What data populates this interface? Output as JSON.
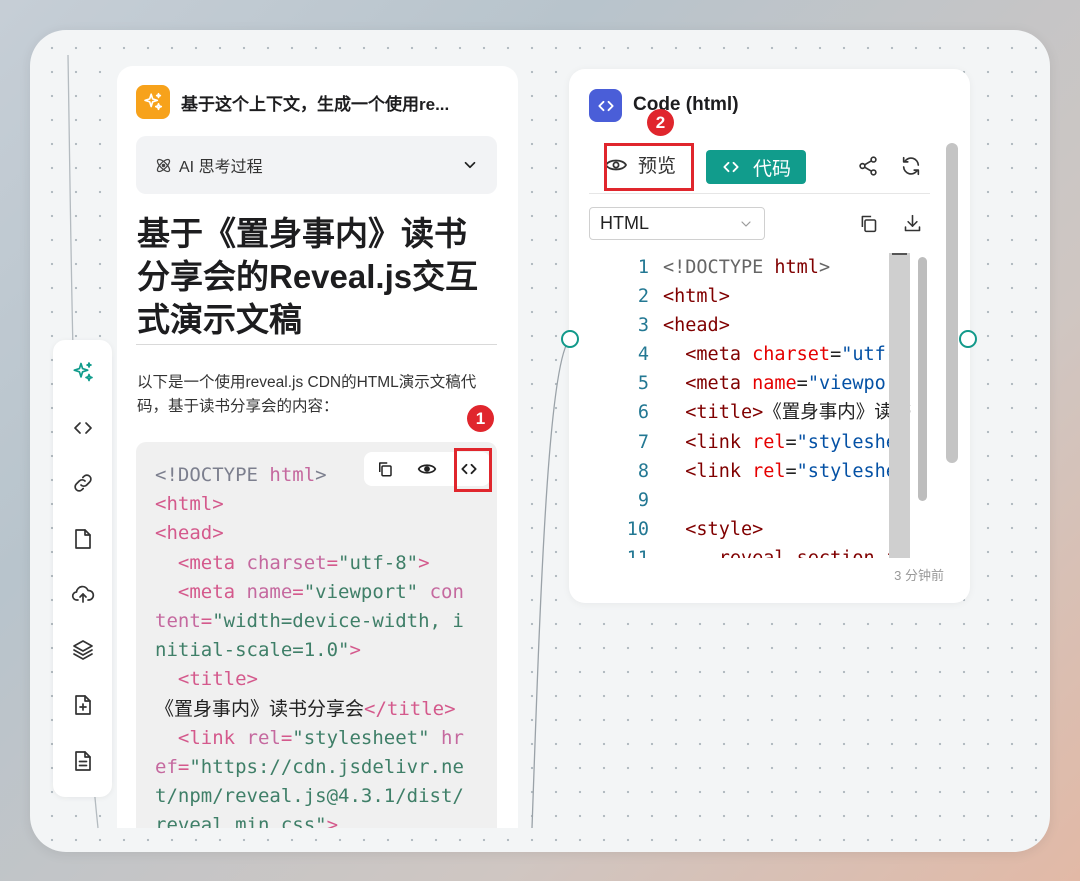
{
  "toolbar": {
    "items": [
      {
        "icon": "sparkle-icon",
        "active": true
      },
      {
        "icon": "code-icon"
      },
      {
        "icon": "link-icon"
      },
      {
        "icon": "file-icon"
      },
      {
        "icon": "cloud-upload-icon"
      },
      {
        "icon": "layers-icon"
      },
      {
        "icon": "file-add-icon"
      },
      {
        "icon": "document-icon"
      }
    ]
  },
  "chat": {
    "title": "基于这个上下文，生成一个使用re...",
    "thinking_label": "AI 思考过程",
    "heading": "基于《置身事内》读书分享会的Reveal.js交互式演示文稿",
    "intro": "以下是一个使用reveal.js CDN的HTML演示文稿代码，基于读书分享会的内容：",
    "code_lines": [
      [
        {
          "t": "<!DOCTYPE ",
          "c": "gray"
        },
        {
          "t": "html",
          "c": "attr"
        },
        {
          "t": ">",
          "c": "gray"
        }
      ],
      [
        {
          "t": "<html>",
          "c": "tag"
        }
      ],
      [
        {
          "t": "<head>",
          "c": "tag"
        }
      ],
      [
        {
          "t": "  <meta ",
          "c": "tag"
        },
        {
          "t": "charset",
          "c": "attr"
        },
        {
          "t": "=",
          "c": "tag"
        },
        {
          "t": "\"utf-8\"",
          "c": "str"
        },
        {
          "t": ">",
          "c": "tag"
        }
      ],
      [
        {
          "t": "  <meta ",
          "c": "tag"
        },
        {
          "t": "name",
          "c": "attr"
        },
        {
          "t": "=",
          "c": "tag"
        },
        {
          "t": "\"viewport\"",
          "c": "str"
        },
        {
          "t": " con",
          "c": "attr"
        }
      ],
      [
        {
          "t": "tent",
          "c": "attr"
        },
        {
          "t": "=",
          "c": "tag"
        },
        {
          "t": "\"width=device-width, i",
          "c": "str"
        }
      ],
      [
        {
          "t": "nitial-scale=1.0\"",
          "c": "str"
        },
        {
          "t": ">",
          "c": "tag"
        }
      ],
      [
        {
          "t": "  <title>",
          "c": "tag"
        }
      ],
      [
        {
          "t": "《置身事内》读书分享会",
          "c": "plain"
        },
        {
          "t": "</title>",
          "c": "tag"
        }
      ],
      [
        {
          "t": "  <link ",
          "c": "tag"
        },
        {
          "t": "rel",
          "c": "attr"
        },
        {
          "t": "=",
          "c": "tag"
        },
        {
          "t": "\"stylesheet\"",
          "c": "str"
        },
        {
          "t": " hr",
          "c": "attr"
        }
      ],
      [
        {
          "t": "ef",
          "c": "attr"
        },
        {
          "t": "=",
          "c": "tag"
        },
        {
          "t": "\"https://cdn.jsdelivr.ne",
          "c": "str"
        }
      ],
      [
        {
          "t": "t/npm/reveal.js@4.3.1/dist/",
          "c": "str"
        }
      ],
      [
        {
          "t": "reveal.min.css\"",
          "c": "str"
        },
        {
          "t": ">",
          "c": "tag"
        }
      ]
    ]
  },
  "preview": {
    "title": "Code (html)",
    "tab_preview": "预览",
    "tab_code": "代码",
    "language": "HTML",
    "line_numbers": [
      "1",
      "2",
      "3",
      "4",
      "5",
      "6",
      "7",
      "8",
      "9",
      "10",
      "11"
    ],
    "code_lines": [
      [
        {
          "t": "<!DOCTYPE ",
          "c": "gray"
        },
        {
          "t": "html",
          "c": "tag"
        },
        {
          "t": ">",
          "c": "gray"
        }
      ],
      [
        {
          "t": "<html>",
          "c": "tag"
        }
      ],
      [
        {
          "t": "<head>",
          "c": "tag"
        }
      ],
      [
        {
          "t": "  <meta ",
          "c": "tag"
        },
        {
          "t": "charset",
          "c": "attr"
        },
        {
          "t": "=",
          "c": "plain"
        },
        {
          "t": "\"utf-",
          "c": "str"
        }
      ],
      [
        {
          "t": "  <meta ",
          "c": "tag"
        },
        {
          "t": "name",
          "c": "attr"
        },
        {
          "t": "=",
          "c": "plain"
        },
        {
          "t": "\"viewpor",
          "c": "str"
        }
      ],
      [
        {
          "t": "  <title>",
          "c": "tag"
        },
        {
          "t": "《置身事内》读书",
          "c": "plain"
        }
      ],
      [
        {
          "t": "  <link ",
          "c": "tag"
        },
        {
          "t": "rel",
          "c": "attr"
        },
        {
          "t": "=",
          "c": "plain"
        },
        {
          "t": "\"styleshe",
          "c": "str"
        }
      ],
      [
        {
          "t": "  <link ",
          "c": "tag"
        },
        {
          "t": "rel",
          "c": "attr"
        },
        {
          "t": "=",
          "c": "plain"
        },
        {
          "t": "\"styleshe",
          "c": "str"
        }
      ],
      [
        {
          "t": "",
          "c": "plain"
        }
      ],
      [
        {
          "t": "  <style>",
          "c": "tag"
        }
      ],
      [
        {
          "t": "    .reveal section i",
          "c": "tag"
        }
      ]
    ],
    "timestamp": "3 分钟前"
  },
  "annotations": [
    {
      "label": "1"
    },
    {
      "label": "2"
    }
  ],
  "colors": {
    "accent": "#119c8c",
    "ai_badge": "#f7a21b",
    "code_badge": "#4a5ed8",
    "highlight": "#e0262d"
  }
}
